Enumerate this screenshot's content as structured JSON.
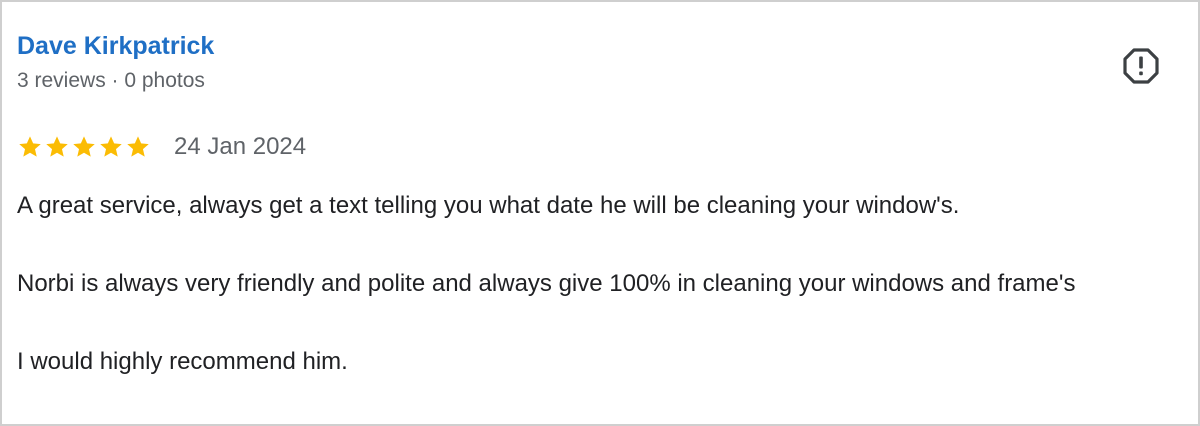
{
  "review": {
    "author": "Dave Kirkpatrick",
    "meta": "3 reviews · 0 photos",
    "rating": 5,
    "rating_max": 5,
    "star_color": "#fbbc04",
    "date": "24 Jan 2024",
    "paragraphs": [
      "A great service, always get a text telling you what date he will be cleaning your window's.",
      "Norbi is always very friendly and polite and always give 100% in cleaning your windows and frame's",
      "I would highly recommend him."
    ]
  },
  "icons": {
    "report": "report-flag-icon",
    "star": "star-icon"
  },
  "colors": {
    "author_link": "#1f6fc5",
    "secondary_text": "#5f6368",
    "body_text": "#202124"
  }
}
